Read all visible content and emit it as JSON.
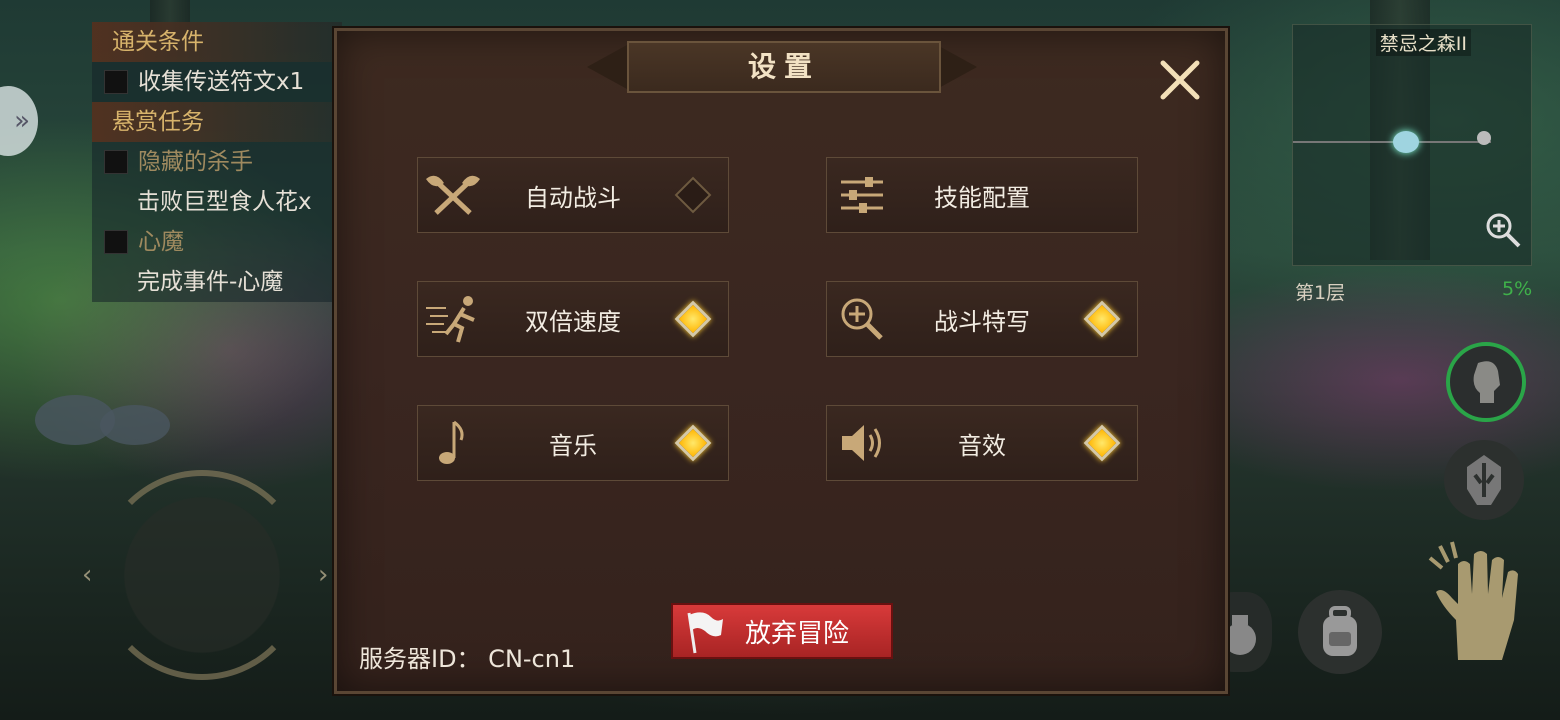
{
  "quest_panel": {
    "clear_conditions_title": "通关条件",
    "clear_conditions": [
      {
        "label": "收集传送符文x1"
      }
    ],
    "bounty_title": "悬赏任务",
    "bounties": [
      {
        "name": "隐藏的杀手",
        "task": "击败巨型食人花x"
      },
      {
        "name": "心魔",
        "task": "完成事件-心魔"
      }
    ]
  },
  "minimap": {
    "area_name": "禁忌之森II",
    "floor": "第1层",
    "progress": "5%",
    "progress_color": "#3fb04a"
  },
  "dialog": {
    "title": "设置",
    "options": [
      {
        "label": "自动战斗",
        "icon": "crossed-axes-icon",
        "enabled": false
      },
      {
        "label": "技能配置",
        "icon": "sliders-icon",
        "enabled": null
      },
      {
        "label": "双倍速度",
        "icon": "running-man-icon",
        "enabled": true
      },
      {
        "label": "战斗特写",
        "icon": "zoom-in-icon",
        "enabled": true
      },
      {
        "label": "音乐",
        "icon": "music-note-icon",
        "enabled": true
      },
      {
        "label": "音效",
        "icon": "speaker-icon",
        "enabled": true
      }
    ],
    "quit_button": "放弃冒险",
    "server_id": "服务器ID：  CN-cn1"
  },
  "colors": {
    "toggle_on": "#ffc21a",
    "quit_button": "#c03030",
    "hero_ring": "#2aa548"
  }
}
